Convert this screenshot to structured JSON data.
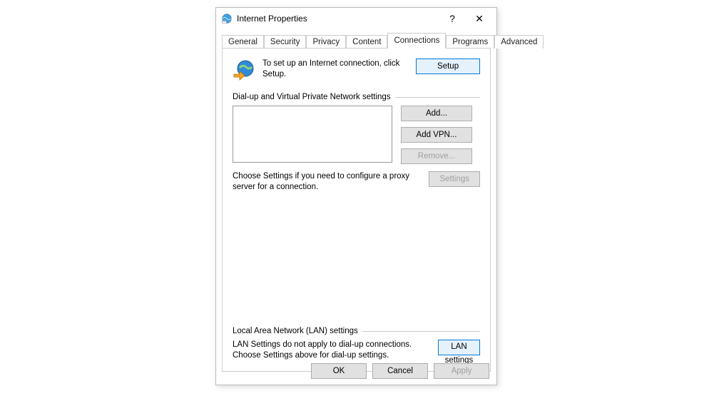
{
  "titlebar": {
    "title": "Internet Properties",
    "help_glyph": "?",
    "close_glyph": "✕"
  },
  "tabs": {
    "general": "General",
    "security": "Security",
    "privacy": "Privacy",
    "content": "Content",
    "connections": "Connections",
    "programs": "Programs",
    "advanced": "Advanced"
  },
  "panel": {
    "intro_text": "To set up an Internet connection, click Setup.",
    "setup_btn": "Setup",
    "dialup_group": "Dial-up and Virtual Private Network settings",
    "add_btn": "Add...",
    "addvpn_btn": "Add VPN...",
    "remove_btn": "Remove...",
    "settings_text": "Choose Settings if you need to configure a proxy server for a connection.",
    "settings_btn": "Settings",
    "lan_group": "Local Area Network (LAN) settings",
    "lan_text": "LAN Settings do not apply to dial-up connections. Choose Settings above for dial-up settings.",
    "lan_btn": "LAN settings"
  },
  "footer": {
    "ok": "OK",
    "cancel": "Cancel",
    "apply": "Apply"
  }
}
